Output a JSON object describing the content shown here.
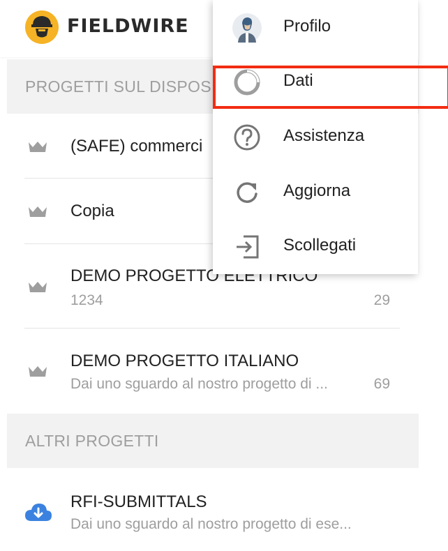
{
  "app": {
    "brand": "FIELDWIRE",
    "brand_icon": "fieldwire-worker-logo-icon",
    "accent_color": "#f5b325"
  },
  "sections": [
    {
      "label": "PROGETTI SUL DISPOS"
    },
    {
      "label": "ALTRI PROGETTI"
    }
  ],
  "projects_device": [
    {
      "title": "(SAFE) commerci",
      "subtitle": "",
      "count": "",
      "icon": "crown-icon"
    },
    {
      "title": "Copia",
      "subtitle": "",
      "count": "",
      "icon": "crown-icon"
    },
    {
      "title": "DEMO PROGETTO ELETTRICO",
      "subtitle": "1234",
      "count": "29",
      "icon": "crown-icon"
    },
    {
      "title": "DEMO PROGETTO ITALIANO",
      "subtitle": "Dai uno sguardo al nostro progetto di ...",
      "count": "69",
      "icon": "crown-icon"
    }
  ],
  "projects_other": [
    {
      "title": "RFI-SUBMITTALS",
      "subtitle": "Dai uno sguardo al nostro progetto di ese...",
      "icon": "cloud-download-icon",
      "icon_color": "#3b82e0"
    }
  ],
  "menu": {
    "items": [
      {
        "label": "Profilo",
        "icon": "avatar-icon"
      },
      {
        "label": "Dati",
        "icon": "data-ring-icon",
        "highlighted": true
      },
      {
        "label": "Assistenza",
        "icon": "help-circle-icon"
      },
      {
        "label": "Aggiorna",
        "icon": "refresh-icon"
      },
      {
        "label": "Scollegati",
        "icon": "logout-icon"
      }
    ],
    "highlight_color": "#f22c12"
  }
}
